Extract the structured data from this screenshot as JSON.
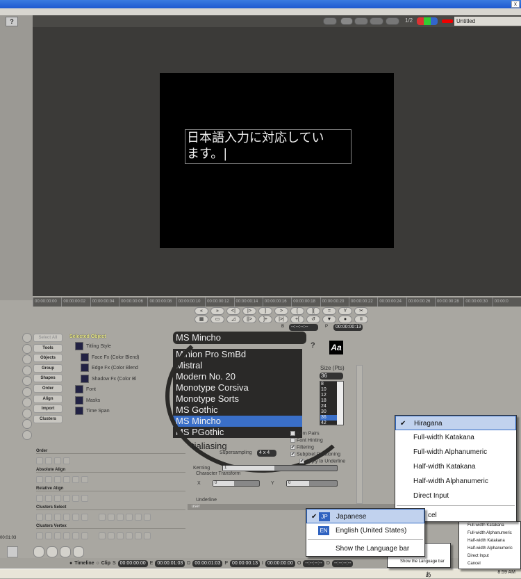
{
  "window": {
    "close_label": "x",
    "help_label": "?",
    "document_title": "Untitled",
    "toolbar_ratio": "1/2"
  },
  "canvas": {
    "text_line1": "日本語入力に対応してい",
    "text_line2": "ます。|"
  },
  "timeline": {
    "ticks": [
      "00:00:00:00",
      "00:00:00:02",
      "00:00:00:04",
      "00:00:00:06",
      "00:00:00:08",
      "00:00:00:10",
      "00:00:00:12",
      "00:00:00:14",
      "00:00:00:16",
      "00:00:00:18",
      "00:00:00:20",
      "00:00:00:22",
      "00:00:00:24",
      "00:00:00:26",
      "00:00:00:28",
      "00:00:00:30",
      "00:00:0"
    ]
  },
  "transport": {
    "row1": [
      "«",
      "»",
      "<|",
      "|>",
      "]",
      ">",
      "[",
      "][",
      "=",
      "Y",
      "✂"
    ],
    "row2": [
      "▦",
      "▭",
      "◿",
      "||>",
      "]+",
      "|>|",
      "+[",
      "↺",
      "▼",
      "●",
      "II"
    ],
    "b_label": "B",
    "b_value": "--:--:--:--",
    "p_label": "P",
    "p_value": "00:00:00:13"
  },
  "side_tools": {
    "icons": [
      "select-arrow",
      "pen",
      "node",
      "frame",
      "eye",
      "path",
      "knife",
      "text",
      "text-cursor",
      "spiral"
    ],
    "categories": [
      "Select All",
      "Tools",
      "Objects",
      "Group",
      "Shapes",
      "Order",
      "Align",
      "Import",
      "Clusters"
    ]
  },
  "selected_object": {
    "header": "Selected Object",
    "items": [
      "Titling Style",
      "Face Fx (Color Blend)",
      "Edge Fx (Color Blend",
      "Shadow Fx (Color Bl",
      "Font",
      "Masks",
      "Time Span"
    ]
  },
  "sections": [
    "Order",
    "Absolute Align",
    "Relative Align",
    "Clusters Select",
    "Clusters Vertex"
  ],
  "font": {
    "selected": "MS Mincho",
    "list": [
      "Minion Pro SmBd",
      "Mistral",
      "Modern No. 20",
      "Monotype Corsiva",
      "Monotype Sorts",
      "MS Gothic",
      "MS Mincho",
      "MS PGothic"
    ],
    "selected_index": 6,
    "size_label": "Size (Pts)",
    "size_value": "36",
    "sizes": [
      "8",
      "10",
      "12",
      "18",
      "24",
      "30",
      "36",
      "42"
    ],
    "selected_size_index": 6,
    "antialiasing_label": "tialiasing",
    "supersampling_label": "Supersampling",
    "supersampling_value": "4 x 4",
    "kern_pairs": "Kern Pairs",
    "font_hinting": "Font Hinting",
    "filtering": "Filtering",
    "subpixel": "Subpixel Positioning",
    "apply_underline": "Apply to Underline",
    "kerning_label": "Kerning",
    "kerning_value": "1",
    "char_transform": "Character Transform",
    "x_label": "X",
    "x_value": "0",
    "y_label": "Y",
    "y_value": "0",
    "underline_label": "Underline",
    "user_label": "user",
    "checks": {
      "kern_pairs": false,
      "font_hinting": false,
      "filtering": true,
      "subpixel": true,
      "apply_underline": true
    }
  },
  "ime_menu": {
    "items": [
      "Hiragana",
      "Full-width Katakana",
      "Full-width Alphanumeric",
      "Half-width Katakana",
      "Half-width Alphanumeric",
      "Direct Input",
      "Cancel"
    ],
    "checked_index": 0,
    "cancel_partial": "cel"
  },
  "lang_menu": {
    "items": [
      {
        "badge": "JP",
        "label": "Japanese"
      },
      {
        "badge": "EN",
        "label": "English (United States)"
      }
    ],
    "show_bar": "Show the Language bar",
    "checked_index": 0
  },
  "small_lang_menu": {
    "partial": "l States)",
    "show_bar": "Show the Language bar"
  },
  "small_ime_menu": {
    "items": [
      "Full-width Katakana",
      "Full-width Alphanumeric",
      "Half-width Katakana",
      "Half-width Alphanumeric",
      "Direct Input",
      "Cancel"
    ]
  },
  "status": {
    "timeline_label": "Timeline",
    "clip_label": "Clip",
    "mode": "Timeline",
    "s": "00:00:00:00",
    "e": "00:00:01:03",
    "d": "00:00:01:03",
    "p": "00:00:00:13",
    "i": "00:00:00:00",
    "o": "--:--:--:--",
    "d2": "--:--:--:--",
    "left_time": "00:01:03",
    "labels": [
      "S",
      "E",
      "D",
      "P",
      "I",
      "O",
      "D"
    ]
  },
  "taskbar": {
    "clock": "8:59 AM",
    "ime_char": "あ"
  }
}
